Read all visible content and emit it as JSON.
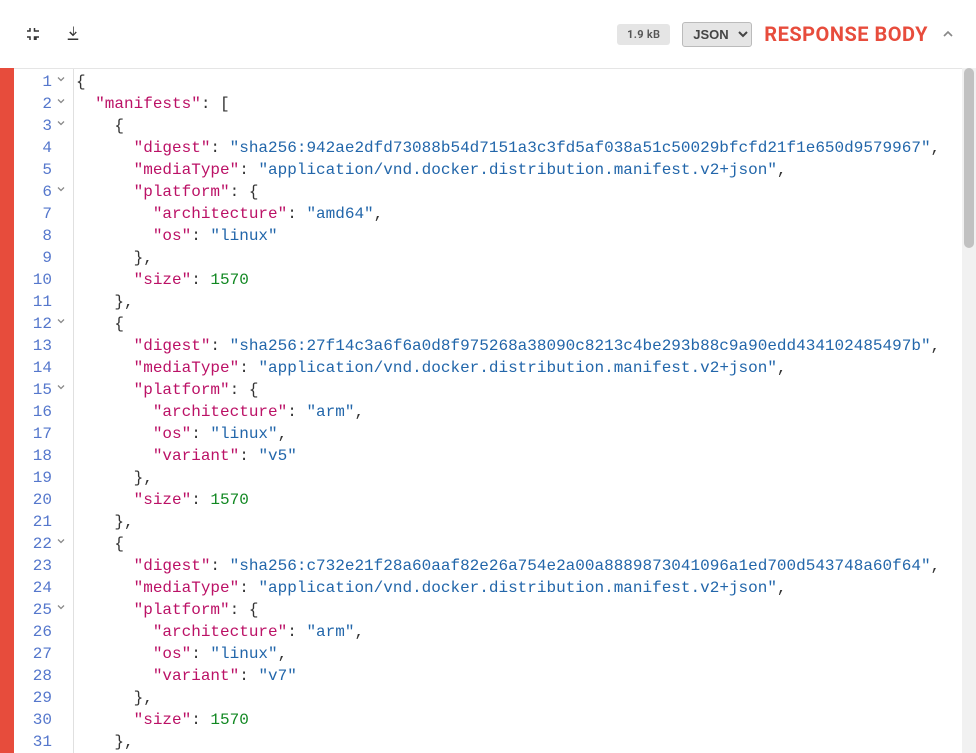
{
  "header": {
    "size_value": "1.9",
    "size_unit": "kB",
    "format": "JSON",
    "title": "RESPONSE BODY"
  },
  "lines": [
    {
      "num": 1,
      "fold": true,
      "indent": 0,
      "parts": [
        {
          "t": "{",
          "c": "p"
        }
      ]
    },
    {
      "num": 2,
      "fold": true,
      "indent": 1,
      "parts": [
        {
          "t": "\"manifests\"",
          "c": "k"
        },
        {
          "t": ": [",
          "c": "p"
        }
      ]
    },
    {
      "num": 3,
      "fold": true,
      "indent": 2,
      "parts": [
        {
          "t": "{",
          "c": "p"
        }
      ]
    },
    {
      "num": 4,
      "fold": false,
      "indent": 3,
      "parts": [
        {
          "t": "\"digest\"",
          "c": "k"
        },
        {
          "t": ": ",
          "c": "p"
        },
        {
          "t": "\"sha256:942ae2dfd73088b54d7151a3c3fd5af038a51c50029bfcfd21f1e650d9579967\"",
          "c": "s"
        },
        {
          "t": ",",
          "c": "p"
        }
      ]
    },
    {
      "num": 5,
      "fold": false,
      "indent": 3,
      "parts": [
        {
          "t": "\"mediaType\"",
          "c": "k"
        },
        {
          "t": ": ",
          "c": "p"
        },
        {
          "t": "\"application/vnd.docker.distribution.manifest.v2+json\"",
          "c": "s"
        },
        {
          "t": ",",
          "c": "p"
        }
      ]
    },
    {
      "num": 6,
      "fold": true,
      "indent": 3,
      "parts": [
        {
          "t": "\"platform\"",
          "c": "k"
        },
        {
          "t": ": {",
          "c": "p"
        }
      ]
    },
    {
      "num": 7,
      "fold": false,
      "indent": 4,
      "parts": [
        {
          "t": "\"architecture\"",
          "c": "k"
        },
        {
          "t": ": ",
          "c": "p"
        },
        {
          "t": "\"amd64\"",
          "c": "s"
        },
        {
          "t": ",",
          "c": "p"
        }
      ]
    },
    {
      "num": 8,
      "fold": false,
      "indent": 4,
      "parts": [
        {
          "t": "\"os\"",
          "c": "k"
        },
        {
          "t": ": ",
          "c": "p"
        },
        {
          "t": "\"linux\"",
          "c": "s"
        }
      ]
    },
    {
      "num": 9,
      "fold": false,
      "indent": 3,
      "parts": [
        {
          "t": "},",
          "c": "p"
        }
      ]
    },
    {
      "num": 10,
      "fold": false,
      "indent": 3,
      "parts": [
        {
          "t": "\"size\"",
          "c": "k"
        },
        {
          "t": ": ",
          "c": "p"
        },
        {
          "t": "1570",
          "c": "n"
        }
      ]
    },
    {
      "num": 11,
      "fold": false,
      "indent": 2,
      "parts": [
        {
          "t": "},",
          "c": "p"
        }
      ]
    },
    {
      "num": 12,
      "fold": true,
      "indent": 2,
      "parts": [
        {
          "t": "{",
          "c": "p"
        }
      ]
    },
    {
      "num": 13,
      "fold": false,
      "indent": 3,
      "parts": [
        {
          "t": "\"digest\"",
          "c": "k"
        },
        {
          "t": ": ",
          "c": "p"
        },
        {
          "t": "\"sha256:27f14c3a6f6a0d8f975268a38090c8213c4be293b88c9a90edd434102485497b\"",
          "c": "s"
        },
        {
          "t": ",",
          "c": "p"
        }
      ]
    },
    {
      "num": 14,
      "fold": false,
      "indent": 3,
      "parts": [
        {
          "t": "\"mediaType\"",
          "c": "k"
        },
        {
          "t": ": ",
          "c": "p"
        },
        {
          "t": "\"application/vnd.docker.distribution.manifest.v2+json\"",
          "c": "s"
        },
        {
          "t": ",",
          "c": "p"
        }
      ]
    },
    {
      "num": 15,
      "fold": true,
      "indent": 3,
      "parts": [
        {
          "t": "\"platform\"",
          "c": "k"
        },
        {
          "t": ": {",
          "c": "p"
        }
      ]
    },
    {
      "num": 16,
      "fold": false,
      "indent": 4,
      "parts": [
        {
          "t": "\"architecture\"",
          "c": "k"
        },
        {
          "t": ": ",
          "c": "p"
        },
        {
          "t": "\"arm\"",
          "c": "s"
        },
        {
          "t": ",",
          "c": "p"
        }
      ]
    },
    {
      "num": 17,
      "fold": false,
      "indent": 4,
      "parts": [
        {
          "t": "\"os\"",
          "c": "k"
        },
        {
          "t": ": ",
          "c": "p"
        },
        {
          "t": "\"linux\"",
          "c": "s"
        },
        {
          "t": ",",
          "c": "p"
        }
      ]
    },
    {
      "num": 18,
      "fold": false,
      "indent": 4,
      "parts": [
        {
          "t": "\"variant\"",
          "c": "k"
        },
        {
          "t": ": ",
          "c": "p"
        },
        {
          "t": "\"v5\"",
          "c": "s"
        }
      ]
    },
    {
      "num": 19,
      "fold": false,
      "indent": 3,
      "parts": [
        {
          "t": "},",
          "c": "p"
        }
      ]
    },
    {
      "num": 20,
      "fold": false,
      "indent": 3,
      "parts": [
        {
          "t": "\"size\"",
          "c": "k"
        },
        {
          "t": ": ",
          "c": "p"
        },
        {
          "t": "1570",
          "c": "n"
        }
      ]
    },
    {
      "num": 21,
      "fold": false,
      "indent": 2,
      "parts": [
        {
          "t": "},",
          "c": "p"
        }
      ]
    },
    {
      "num": 22,
      "fold": true,
      "indent": 2,
      "parts": [
        {
          "t": "{",
          "c": "p"
        }
      ]
    },
    {
      "num": 23,
      "fold": false,
      "indent": 3,
      "parts": [
        {
          "t": "\"digest\"",
          "c": "k"
        },
        {
          "t": ": ",
          "c": "p"
        },
        {
          "t": "\"sha256:c732e21f28a60aaf82e26a754e2a00a8889873041096a1ed700d543748a60f64\"",
          "c": "s"
        },
        {
          "t": ",",
          "c": "p"
        }
      ]
    },
    {
      "num": 24,
      "fold": false,
      "indent": 3,
      "parts": [
        {
          "t": "\"mediaType\"",
          "c": "k"
        },
        {
          "t": ": ",
          "c": "p"
        },
        {
          "t": "\"application/vnd.docker.distribution.manifest.v2+json\"",
          "c": "s"
        },
        {
          "t": ",",
          "c": "p"
        }
      ]
    },
    {
      "num": 25,
      "fold": true,
      "indent": 3,
      "parts": [
        {
          "t": "\"platform\"",
          "c": "k"
        },
        {
          "t": ": {",
          "c": "p"
        }
      ]
    },
    {
      "num": 26,
      "fold": false,
      "indent": 4,
      "parts": [
        {
          "t": "\"architecture\"",
          "c": "k"
        },
        {
          "t": ": ",
          "c": "p"
        },
        {
          "t": "\"arm\"",
          "c": "s"
        },
        {
          "t": ",",
          "c": "p"
        }
      ]
    },
    {
      "num": 27,
      "fold": false,
      "indent": 4,
      "parts": [
        {
          "t": "\"os\"",
          "c": "k"
        },
        {
          "t": ": ",
          "c": "p"
        },
        {
          "t": "\"linux\"",
          "c": "s"
        },
        {
          "t": ",",
          "c": "p"
        }
      ]
    },
    {
      "num": 28,
      "fold": false,
      "indent": 4,
      "parts": [
        {
          "t": "\"variant\"",
          "c": "k"
        },
        {
          "t": ": ",
          "c": "p"
        },
        {
          "t": "\"v7\"",
          "c": "s"
        }
      ]
    },
    {
      "num": 29,
      "fold": false,
      "indent": 3,
      "parts": [
        {
          "t": "},",
          "c": "p"
        }
      ]
    },
    {
      "num": 30,
      "fold": false,
      "indent": 3,
      "parts": [
        {
          "t": "\"size\"",
          "c": "k"
        },
        {
          "t": ": ",
          "c": "p"
        },
        {
          "t": "1570",
          "c": "n"
        }
      ]
    },
    {
      "num": 31,
      "fold": false,
      "indent": 2,
      "parts": [
        {
          "t": "},",
          "c": "p"
        }
      ]
    }
  ]
}
